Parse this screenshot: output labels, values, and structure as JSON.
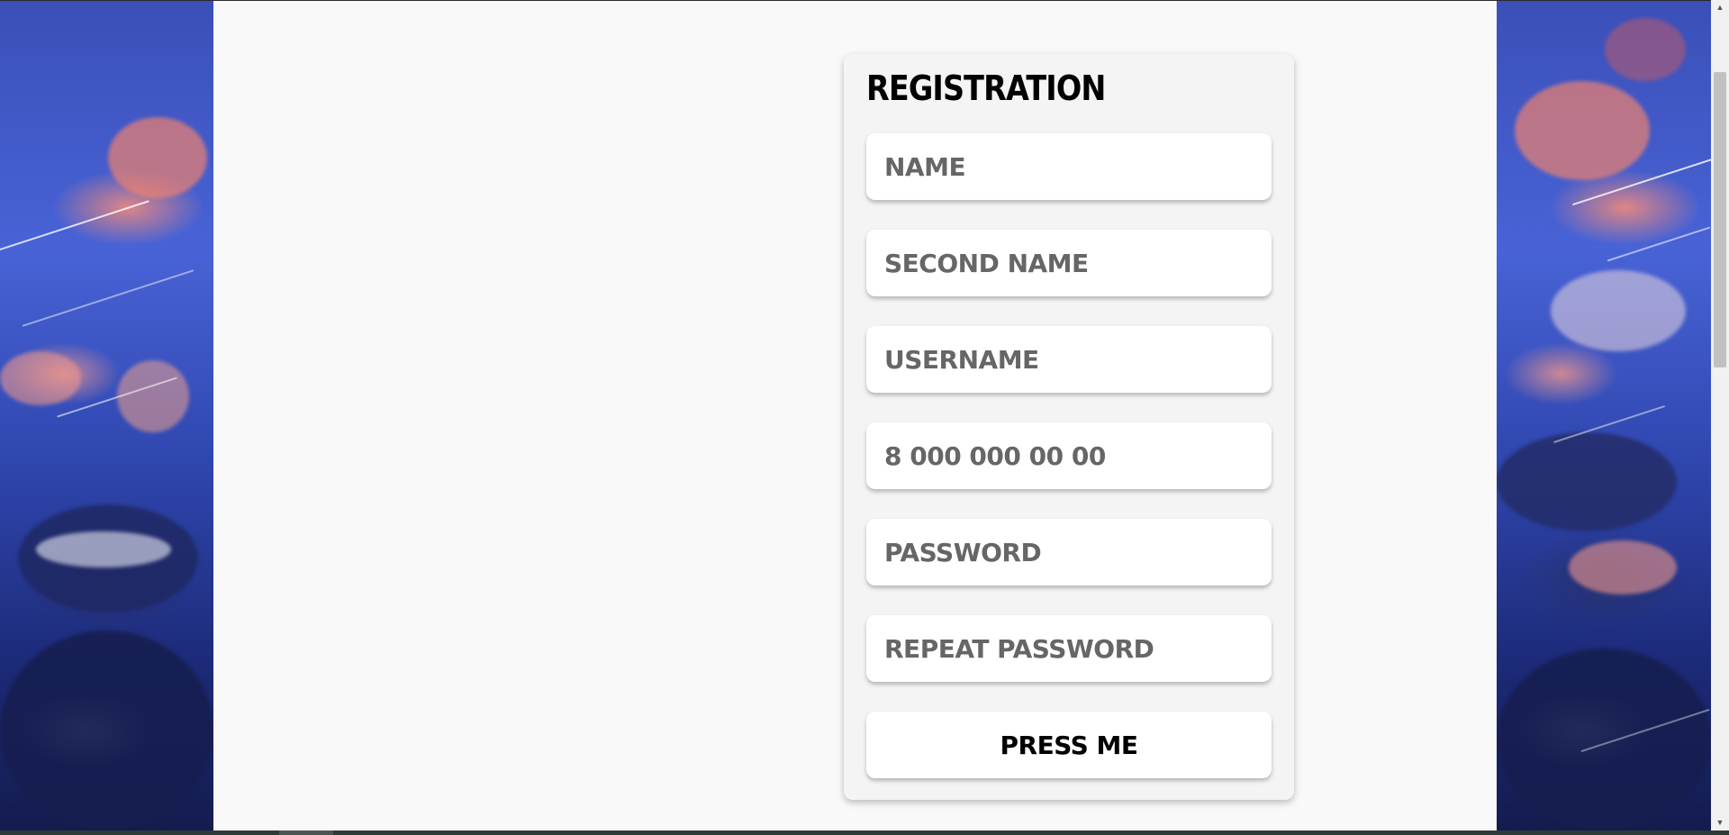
{
  "form": {
    "title": "REGISTRATION",
    "fields": [
      {
        "name": "name-input",
        "placeholder": "NAME",
        "value": ""
      },
      {
        "name": "second-name-input",
        "placeholder": "SECOND NAME",
        "value": ""
      },
      {
        "name": "username-input",
        "placeholder": "USERNAME",
        "value": ""
      },
      {
        "name": "phone-input",
        "placeholder": "8 000 000 00 00",
        "value": ""
      },
      {
        "name": "password-input",
        "placeholder": "PASSWORD",
        "value": ""
      },
      {
        "name": "repeat-password-input",
        "placeholder": "REPEAT PASSWORD",
        "value": ""
      }
    ],
    "submit_label": "PRESS ME"
  },
  "scrollbar": {
    "up_icon": "triangle-up-icon",
    "down_icon": "triangle-down-icon"
  },
  "colors": {
    "page_bg": "#f9f9f9",
    "card_bg": "#f4f4f4",
    "placeholder": "#666666",
    "sky": "#4863d6"
  }
}
